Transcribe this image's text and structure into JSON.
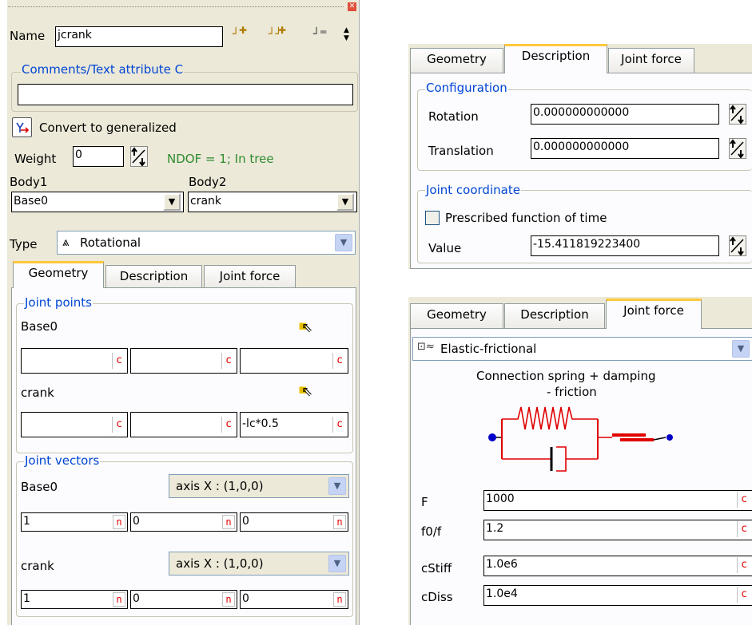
{
  "left": {
    "name_label": "Name",
    "name_value": "jcrank",
    "comments_title": "Comments/Text attribute C",
    "comments_value": "",
    "convert_label": "Convert to generalized",
    "weight_label": "Weight",
    "weight_value": "0",
    "ndof_text": "NDOF = 1; In tree",
    "body1_label": "Body1",
    "body1_value": "Base0",
    "body2_label": "Body2",
    "body2_value": "crank",
    "type_label": "Type",
    "type_value": "Rotational",
    "tabs": [
      "Geometry",
      "Description",
      "Joint force"
    ],
    "joint_points": {
      "title": "Joint points",
      "base_label": "Base0",
      "base_values": [
        "",
        "",
        ""
      ],
      "crank_label": "crank",
      "crank_values": [
        "",
        "",
        "-lc*0.5"
      ]
    },
    "joint_vectors": {
      "title": "Joint vectors",
      "base_label": "Base0",
      "base_axis": "axis X : (1,0,0)",
      "base_values": [
        "1",
        "0",
        "0"
      ],
      "crank_label": "crank",
      "crank_axis": "axis X : (1,0,0)",
      "crank_values": [
        "1",
        "0",
        "0"
      ]
    },
    "c_marker": "c",
    "n_marker": "n"
  },
  "topright": {
    "tabs": [
      "Geometry",
      "Description",
      "Joint force"
    ],
    "config_title": "Configuration",
    "rotation_label": "Rotation",
    "rotation_value": "0.000000000000",
    "translation_label": "Translation",
    "translation_value": "0.000000000000",
    "coord_title": "Joint coordinate",
    "prescribed_label": "Prescribed function of time",
    "value_label": "Value",
    "value_value": "-15.411819223400"
  },
  "bottomright": {
    "tabs": [
      "Geometry",
      "Description",
      "Joint force"
    ],
    "force_type": "Elastic-frictional",
    "caption_line1": "Connection spring + damping",
    "caption_line2": "- friction",
    "params": [
      {
        "label": "F",
        "value": "1000"
      },
      {
        "label": "f0/f",
        "value": "1.2"
      },
      {
        "label": "cStiff",
        "value": "1.0e6"
      },
      {
        "label": "cDiss",
        "value": "1.0e4"
      }
    ],
    "c_marker": "c"
  },
  "colors": {
    "panel_bg": "#ece9d8",
    "group_title": "#0046d5",
    "marker_red": "#e00000",
    "tab_highlight": "#ffc83c"
  }
}
